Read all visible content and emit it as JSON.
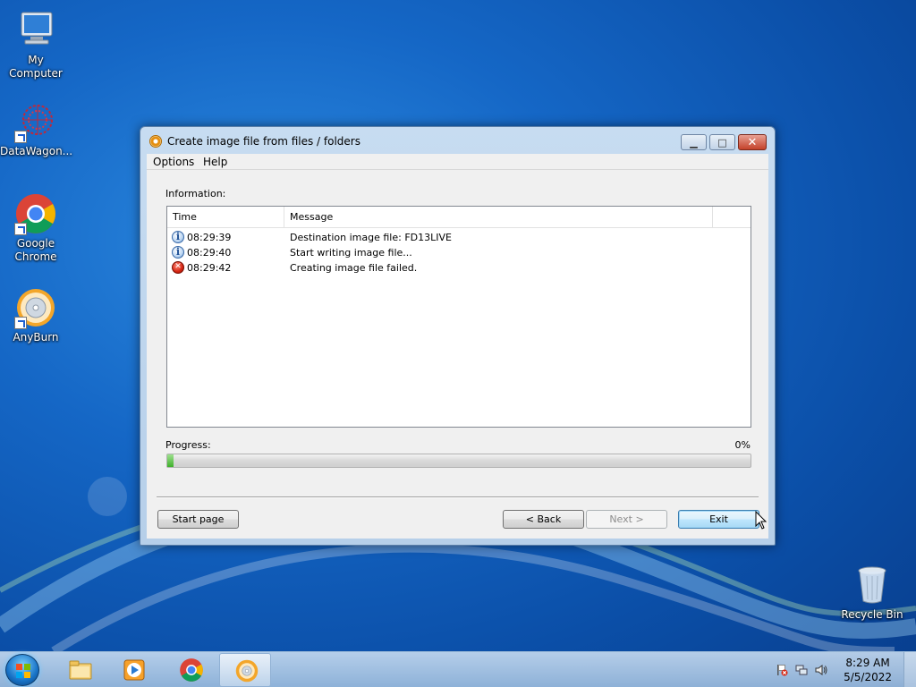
{
  "desktop": {
    "icons": [
      {
        "label": "My Computer",
        "icon": "computer-icon"
      },
      {
        "label": "DataWagon...",
        "icon": "datawagon-icon"
      },
      {
        "label": "Google Chrome",
        "icon": "chrome-icon"
      },
      {
        "label": "AnyBurn",
        "icon": "anyburn-icon"
      },
      {
        "label": "Recycle Bin",
        "icon": "recycle-bin-icon"
      }
    ]
  },
  "window": {
    "title": "Create image file from files / folders",
    "menu": [
      "Options",
      "Help"
    ],
    "information_label": "Information:",
    "columns": [
      "Time",
      "Message"
    ],
    "log": [
      {
        "type": "info",
        "time": "08:29:39",
        "message": "Destination image file:  FD13LIVE"
      },
      {
        "type": "info",
        "time": "08:29:40",
        "message": "Start writing image file..."
      },
      {
        "type": "error",
        "time": "08:29:42",
        "message": "Creating image file failed."
      }
    ],
    "progress_label": "Progress:",
    "progress_percent_text": "0%",
    "progress_value": 0.01,
    "buttons": {
      "start_page": "Start page",
      "back": "< Back",
      "next": "Next >",
      "exit": "Exit"
    }
  },
  "taskbar": {
    "apps": [
      "windows-explorer-icon",
      "media-player-icon",
      "chrome-icon",
      "anyburn-icon"
    ],
    "clock_time": "8:29 AM",
    "clock_date": "5/5/2022"
  },
  "colors": {
    "progress_green": "#3fb02b",
    "error_red": "#d52411",
    "info_blue": "#1e4f95"
  }
}
